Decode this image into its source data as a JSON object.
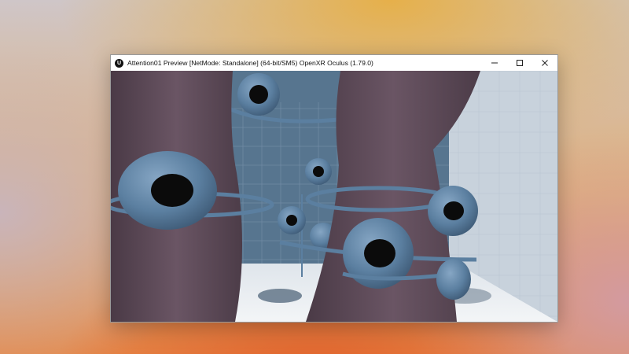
{
  "window": {
    "title": "Attention01 Preview [NetMode: Standalone]  (64-bit/SM5) OpenXR Oculus (1.79.0)",
    "logo_letter": "U"
  },
  "controls": {
    "minimize_icon": "minimize-icon",
    "maximize_icon": "maximize-icon",
    "close_icon": "close-icon"
  },
  "viewport": {
    "sky_color": "#4f6d8c",
    "wall_color": "#5f7b96",
    "floor_color": "#e9edf1",
    "pillar_color": "#5e4b58",
    "eye_color": "#5b7fa0"
  }
}
